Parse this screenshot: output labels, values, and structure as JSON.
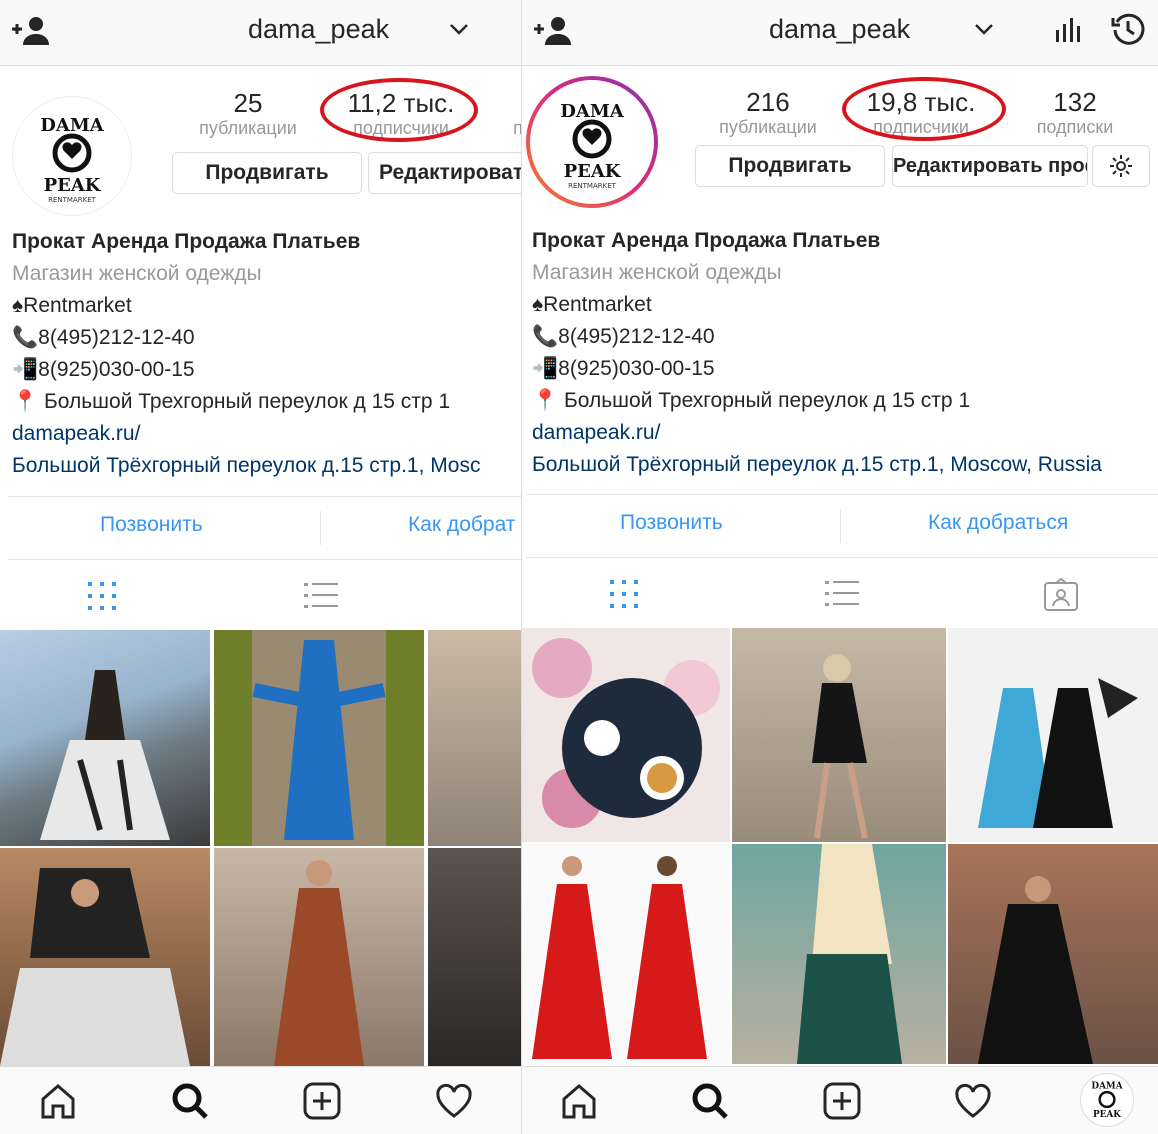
{
  "left": {
    "username": "dama_peak",
    "stats": [
      {
        "num": "25",
        "label": "публикации"
      },
      {
        "num": "11,2 тыс.",
        "label": "подписчики"
      }
    ],
    "stats_cut_label": "п",
    "buttons": {
      "promote": "Продвигать",
      "edit": "Редактировать пр"
    },
    "actions": {
      "call": "Позвонить",
      "directions": "Как добрат"
    },
    "address_link": "Большой Трёхгорный переулок д.15 стр.1, Mosc"
  },
  "right": {
    "username": "dama_peak",
    "stats": [
      {
        "num": "216",
        "label": "публикации"
      },
      {
        "num": "19,8 тыс.",
        "label": "подписчики"
      },
      {
        "num": "132",
        "label": "подписки"
      }
    ],
    "buttons": {
      "promote": "Продвигать",
      "edit": "Редактировать профиль"
    },
    "actions": {
      "call": "Позвонить",
      "directions": "Как добраться"
    },
    "address_link": "Большой Трёхгорный переулок д.15 стр.1, Moscow, Russia"
  },
  "bio": {
    "name": "Прокат Аренда Продажа  Платьев",
    "category": "Магазин женской одежды",
    "brand": "♠Rentmarket",
    "phone1": "📞8(495)212-12-40",
    "phone2": "📲8(925)030-00-15",
    "address": "📍 Большой Трехгорный переулок д 15 стр 1",
    "website": "damapeak.ru/"
  },
  "logo": {
    "line1": "DAMA",
    "line2": "PEAK",
    "line3": "RENTMARKET"
  },
  "colors": {
    "accent": "#3897f0",
    "link": "#003569",
    "highlight": "#d8141c",
    "muted": "#999999"
  }
}
